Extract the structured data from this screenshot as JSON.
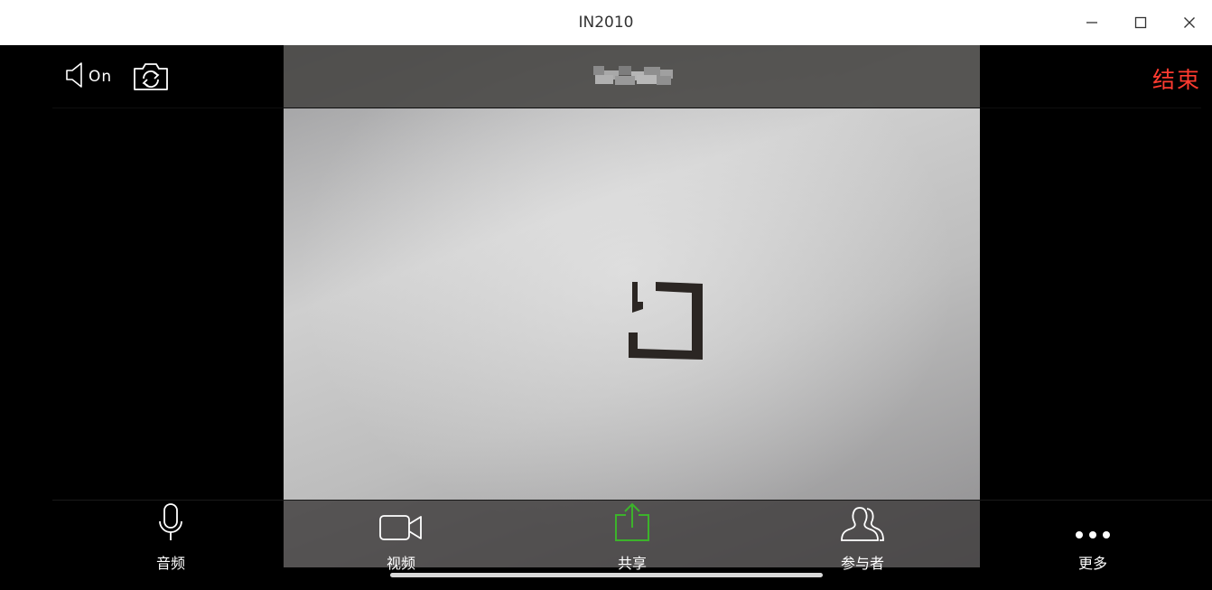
{
  "window": {
    "title": "IN2010",
    "controls": [
      "minimize-icon",
      "maximize-icon",
      "close-icon"
    ]
  },
  "top_bar": {
    "speaker_label": "On",
    "end_label": "结束"
  },
  "toolbar": {
    "items": [
      {
        "label": "音频",
        "icon": "microphone-icon"
      },
      {
        "label": "视频",
        "icon": "video-camera-icon"
      },
      {
        "label": "共享",
        "icon": "share-upload-icon",
        "color": "#3cb32b"
      },
      {
        "label": "参与者",
        "icon": "participants-icon"
      },
      {
        "label": "更多",
        "icon": "more-dots-icon"
      }
    ]
  },
  "colors": {
    "end_red": "#ff3b30",
    "share_green": "#3cb32b",
    "background": "#000000"
  }
}
